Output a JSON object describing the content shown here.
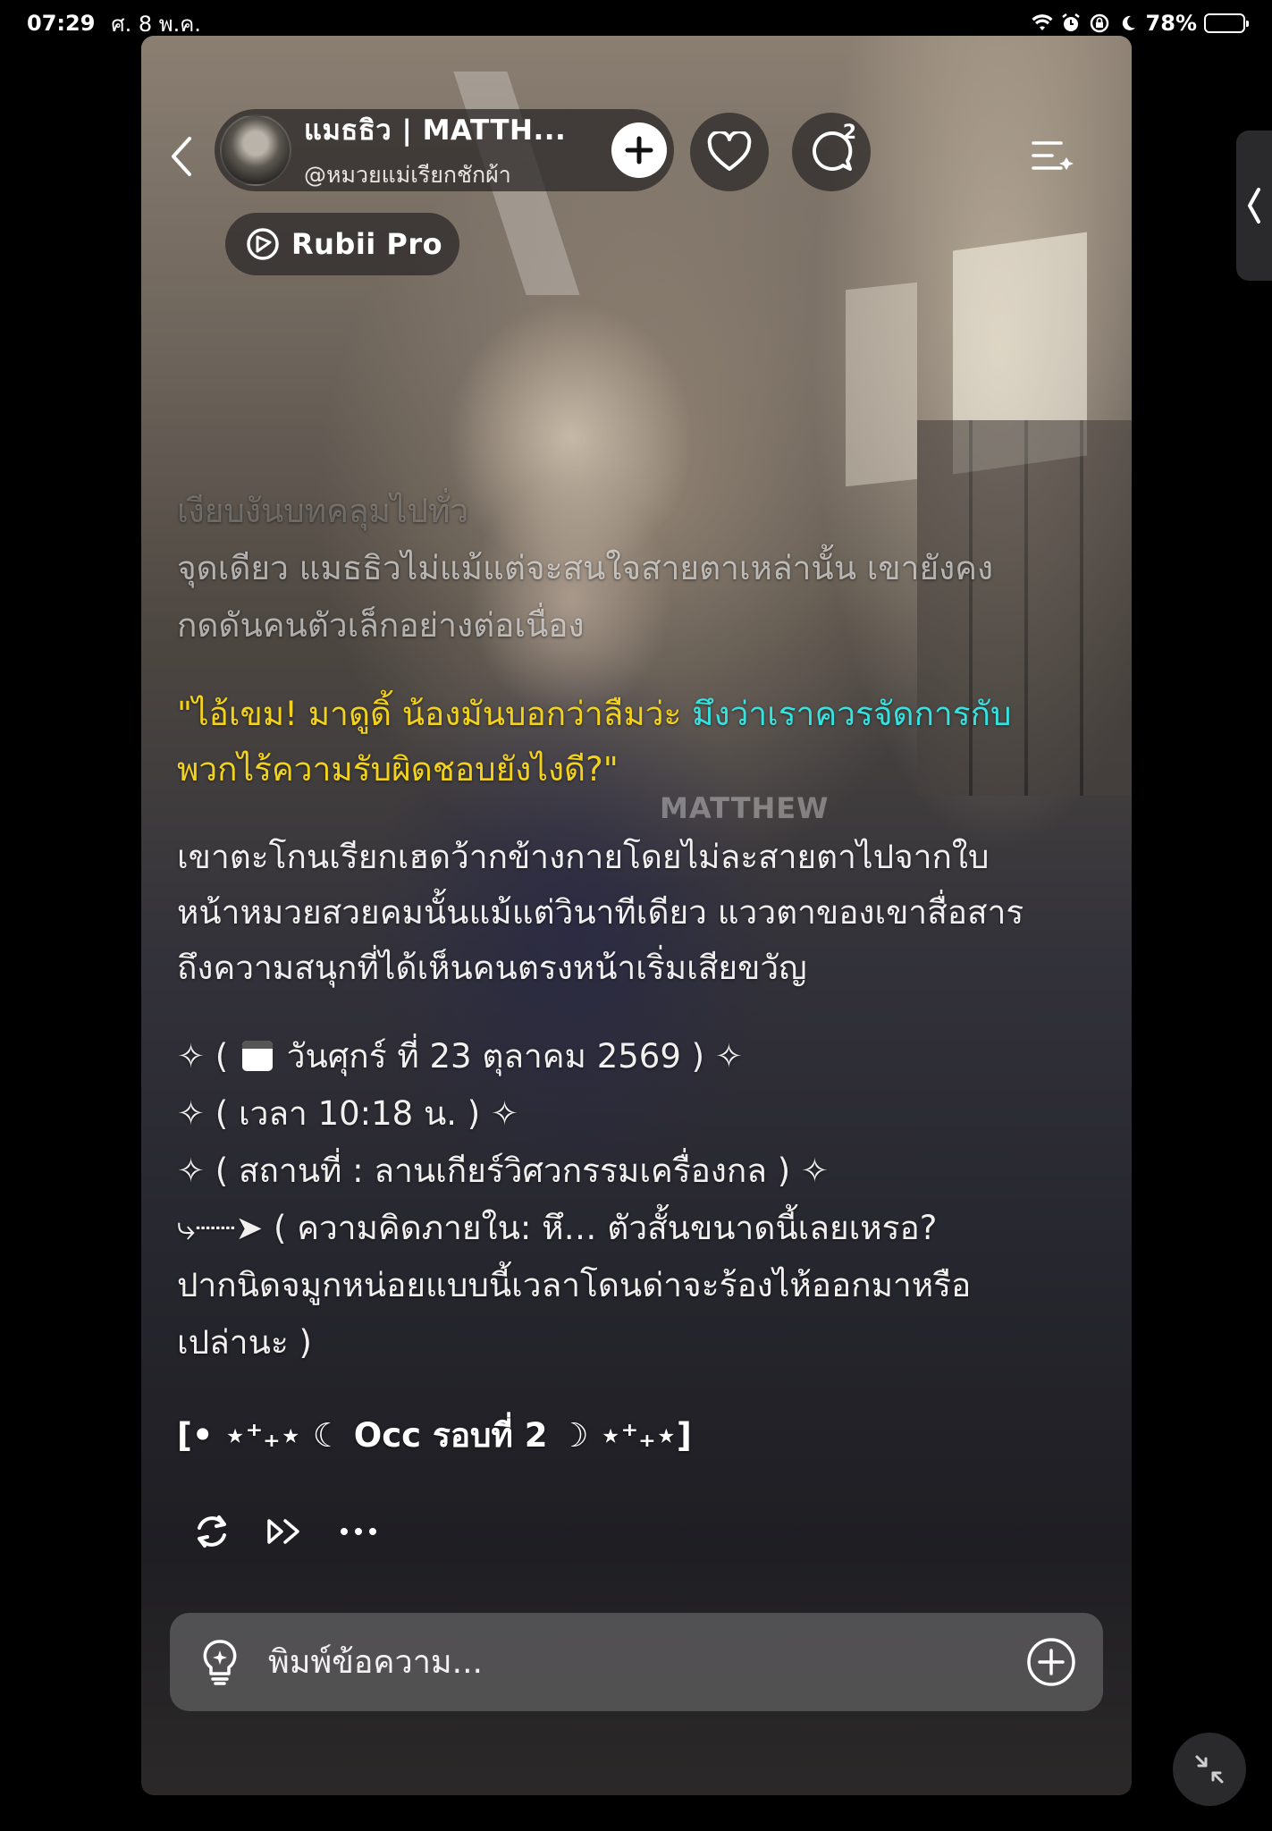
{
  "status_bar": {
    "time": "07:29",
    "date": "ศ. 8 พ.ค.",
    "battery": "78%",
    "icons": [
      "wifi-icon",
      "alarm-icon",
      "screen-lock-icon",
      "moon-icon"
    ]
  },
  "header": {
    "character_name": "แมธธิว | MATTH...",
    "handle": "@หมวยแม่เรียกชักผ้า",
    "comment_count": "2"
  },
  "pro_badge": {
    "label": "Rubii Pro"
  },
  "background": {
    "watermark": "MATTHEW"
  },
  "message": {
    "faded_lines": [
      "เงียบงันบทคลุมไปทั่ว",
      "จุดเดียว แมธธิวไม่แม้แต่จะสนใจสายตาเหล่านั้น เขายังคง",
      "กดดันคนตัวเล็กอย่างต่อเนื่อง"
    ],
    "dialogue_yellow_1": "\"ไอ้เขม! มาดูดิ้ น้องมันบอกว่าลืมว่ะ ",
    "dialogue_cyan": "มึงว่าเราควรจัดการกับ",
    "dialogue_yellow_2": "พวกไร้ความรับผิดชอบยังไงดี?\"",
    "narration_lines": [
      "เขาตะโกนเรียกเฮดว้ากข้างกายโดยไม่ละสายตาไปจากใบ",
      "หน้าหมวยสวยคมนั้นแม้แต่วินาทีเดียว แววตาของเขาสื่อสาร",
      "ถึงความสนุกที่ได้เห็นคนตรงหน้าเริ่มเสียขวัญ"
    ],
    "date_prefix": "✧ ( ",
    "date_text": " วันศุกร์ ที่ 23 ตุลาคม 2569 ) ✧",
    "time_line": "✧ ( เวลา 10:18 น. ) ✧",
    "place_line": "✧ ( สถานที่ : ลานเกียร์วิศวกรรมเครื่องกล ) ✧",
    "thought_line_1": "⤷┈┈➤ ( ความคิดภายใน: หึ… ตัวสั้นขนาดนี้เลยเหรอ?",
    "thought_line_2": "ปากนิดจมูกหน่อยแบบนี้เวลาโดนด่าจะร้องไห้ออกมาหรือ",
    "thought_line_3": "เปล่านะ )",
    "occ_line": "[• ⋆⁺₊⋆ ☾ Occ รอบที่ 2 ☽ ⋆⁺₊⋆]"
  },
  "composer": {
    "placeholder": "พิมพ์ข้อความ..."
  }
}
